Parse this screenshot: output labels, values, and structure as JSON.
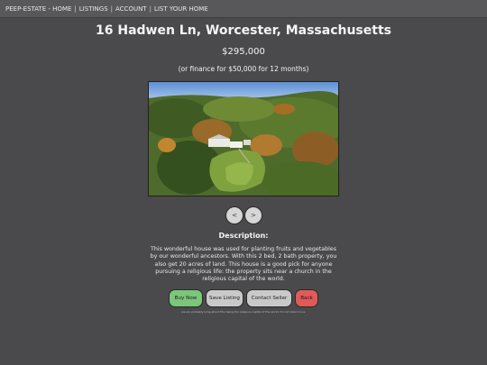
{
  "nav": {
    "items": [
      "PEEP-ESTATE - HOME",
      "LISTINGS",
      "ACCOUNT",
      "LIST YOUR HOME"
    ],
    "separator": "|"
  },
  "listing": {
    "title": "16 Hadwen Ln, Worcester, Massachusetts",
    "price": "$295,000",
    "finance": "(or finance for $50,000 for 12 months)",
    "photo_alt": "Aerial view of a white house surrounded by autumn forest",
    "prev_label": "<",
    "next_label": ">",
    "description_title": "Description:",
    "description": "This wonderful house was used for planting fruits and vegetables by our wonderful ancestors. With this 2 bed, 2 bath property, you also get 20 acres of land. This house is a good pick for anyone pursuing a religious life: the property sits near a church in the religious capital of the world."
  },
  "actions": {
    "buy": "Buy Now",
    "save": "Save Listing",
    "contact": "Contact Seller",
    "back": "Back"
  },
  "disclaimer": "we are probably lying about this being the religious capital of the world. Do not listen to us.",
  "colors": {
    "background": "#4a4a4c",
    "buy": "#7cc57b",
    "neutral": "#c9c9c9",
    "back": "#e05a57"
  }
}
